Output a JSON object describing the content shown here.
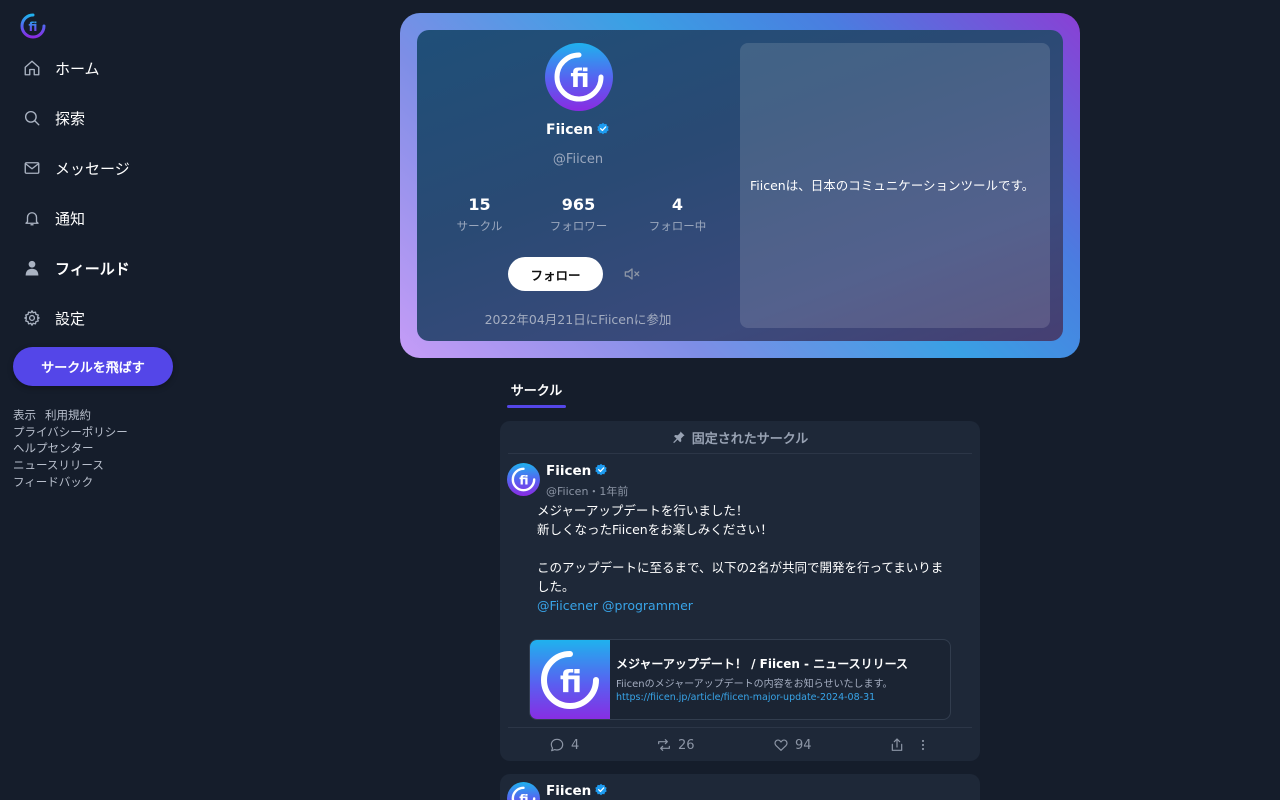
{
  "nav": {
    "items": [
      {
        "label": "ホーム",
        "icon": "home-icon"
      },
      {
        "label": "探索",
        "icon": "search-icon"
      },
      {
        "label": "メッセージ",
        "icon": "mail-icon"
      },
      {
        "label": "通知",
        "icon": "bell-icon"
      },
      {
        "label": "フィールド",
        "icon": "user-icon"
      },
      {
        "label": "設定",
        "icon": "gear-icon"
      }
    ],
    "cta_label": "サークルを飛ばす"
  },
  "footer": {
    "links": [
      "表示",
      "利用規約",
      "プライバシーポリシー",
      "ヘルプセンター",
      "ニュースリリース",
      "フィードバック"
    ]
  },
  "profile": {
    "name": "Fiicen",
    "handle": "@Fiicen",
    "stats": [
      {
        "value": "15",
        "label": "サークル"
      },
      {
        "value": "965",
        "label": "フォロワー"
      },
      {
        "value": "4",
        "label": "フォロー中"
      }
    ],
    "follow_label": "フォロー",
    "joined": "2022年04月21日にFiicenに参加",
    "bio": "Fiicenは、日本のコミュニケーションツールです。"
  },
  "tabs": {
    "circle": "サークル"
  },
  "posts": [
    {
      "pinned_label": "固定されたサークル",
      "author": "Fiicen",
      "meta": "@Fiicen・1年前",
      "lines": [
        "メジャーアップデートを行いました！",
        "新しくなったFiicenをお楽しみください！",
        "",
        "このアップデートに至るまで、以下の2名が共同で開発を行ってまいりま",
        "した。"
      ],
      "mentions": [
        "@Fiicener",
        "@programmer"
      ],
      "link": {
        "title": "メジャーアップデート！ / Fiicen - ニュースリリース",
        "description": "Fiicenのメジャーアップデートの内容をお知らせいたします。",
        "url": "https://fiicen.jp/article/fiicen-major-update-2024-08-31"
      },
      "replies": "4",
      "reposts": "26",
      "likes": "94"
    },
    {
      "author": "Fiicen"
    }
  ],
  "colors": {
    "background": "#151d2b",
    "accent": "#5446e8",
    "link": "#38a4e8",
    "verified": "#1d9bf0"
  }
}
